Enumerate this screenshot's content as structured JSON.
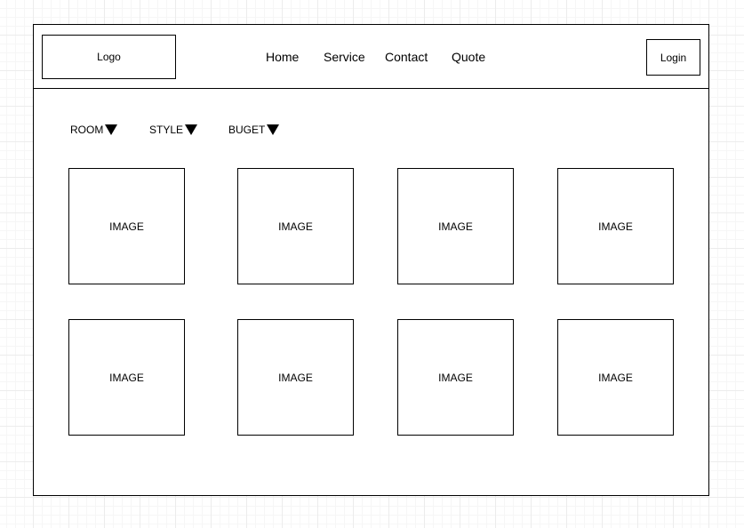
{
  "header": {
    "logo_label": "Logo",
    "nav": [
      "Home",
      "Service",
      "Contact",
      "Quote"
    ],
    "login_label": "Login"
  },
  "filters": [
    {
      "label": "ROOM",
      "icon": "dropdown-triangle-icon"
    },
    {
      "label": "STYLE",
      "icon": "dropdown-triangle-icon"
    },
    {
      "label": "BUGET",
      "icon": "dropdown-triangle-icon"
    }
  ],
  "gallery": {
    "items": [
      "IMAGE",
      "IMAGE",
      "IMAGE",
      "IMAGE",
      "IMAGE",
      "IMAGE",
      "IMAGE",
      "IMAGE"
    ]
  }
}
